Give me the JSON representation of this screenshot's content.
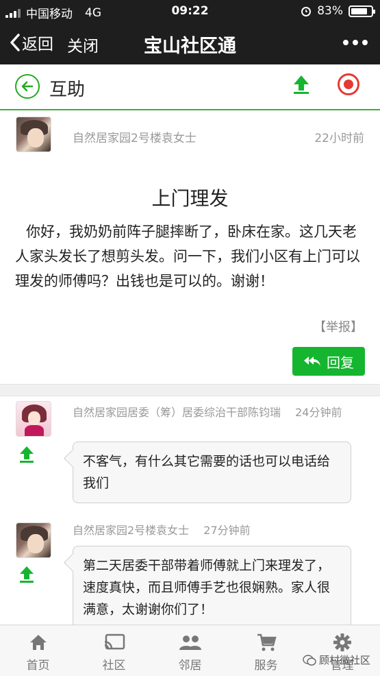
{
  "status": {
    "carrier": "中国移动",
    "network": "4G",
    "time": "09:22",
    "battery": "83%",
    "battery_level": 0.83
  },
  "nav": {
    "back_label": "返回",
    "close_label": "关闭",
    "title": "宝山社区通"
  },
  "header": {
    "title": "互助"
  },
  "post": {
    "author": "自然居家园2号楼袁女士",
    "time": "22小时前",
    "title": "上门理发",
    "body": "你好，我奶奶前阵子腿摔断了，卧床在家。这几天老人家头发长了想剪头发。问一下，我们小区有上门可以理发的师傅吗？出钱也是可以的。谢谢！",
    "report_label": "【举报】",
    "reply_label": "回复"
  },
  "comments": [
    {
      "author_line": "自然居家园居委（筹）居委综治干部陈钧瑞　 24分钟前",
      "text": "不客气，有什么其它需要的话也可以电话给我们"
    },
    {
      "author_line": "自然居家园2号楼袁女士　 27分钟前",
      "text": "第二天居委干部带着师傅就上门来理发了，速度真快，而且师傅手艺也很娴熟。家人很满意，太谢谢你们了！"
    }
  ],
  "tabs": [
    {
      "label": "首页",
      "icon": "home-icon"
    },
    {
      "label": "社区",
      "icon": "cast-icon"
    },
    {
      "label": "邻居",
      "icon": "people-icon"
    },
    {
      "label": "服务",
      "icon": "cart-icon"
    },
    {
      "label": "管理",
      "icon": "gear-icon"
    }
  ],
  "watermark": "顾村微社区",
  "colors": {
    "accent_green": "#15b52f",
    "record_red": "#e53935",
    "nav_dark": "#1e1e1e"
  }
}
